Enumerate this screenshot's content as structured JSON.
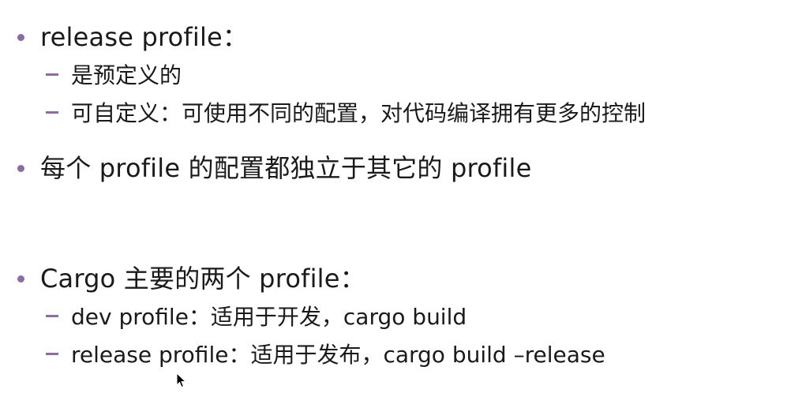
{
  "slide": {
    "bullets": [
      {
        "text": "release profile：",
        "subitems": [
          "是预定义的",
          "可自定义：可使用不同的配置，对代码编译拥有更多的控制"
        ]
      },
      {
        "text": "每个 profile 的配置都独立于其它的 profile",
        "subitems": []
      },
      {
        "text": "Cargo 主要的两个 profile：",
        "subitems": [
          "dev profile：适用于开发，cargo build",
          "release profile：适用于发布，cargo build –release"
        ]
      }
    ]
  },
  "colors": {
    "bullet": "#8d6aa8",
    "text": "#1a1a1a",
    "background": "#ffffff"
  },
  "icons": {
    "cursor": "mouse-pointer-icon"
  }
}
